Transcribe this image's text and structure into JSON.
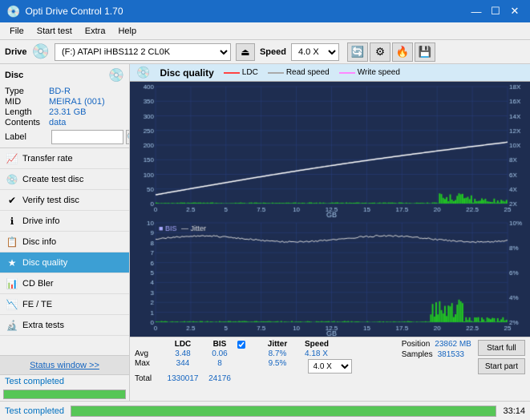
{
  "titleBar": {
    "icon": "💿",
    "title": "Opti Drive Control 1.70",
    "minimizeBtn": "—",
    "maximizeBtn": "☐",
    "closeBtn": "✕"
  },
  "menuBar": {
    "items": [
      "File",
      "Start test",
      "Extra",
      "Help"
    ]
  },
  "driveBar": {
    "label": "Drive",
    "driveValue": "(F:)  ATAPI iHBS112  2 CL0K",
    "speedLabel": "Speed",
    "speedValue": "4.0 X"
  },
  "disc": {
    "title": "Disc",
    "typeLabel": "Type",
    "typeValue": "BD-R",
    "midLabel": "MID",
    "midValue": "MEIRA1 (001)",
    "lengthLabel": "Length",
    "lengthValue": "23.31 GB",
    "contentsLabel": "Contents",
    "contentsValue": "data",
    "labelLabel": "Label"
  },
  "navItems": [
    {
      "id": "transfer-rate",
      "label": "Transfer rate",
      "icon": "📈"
    },
    {
      "id": "create-test-disc",
      "label": "Create test disc",
      "icon": "💿"
    },
    {
      "id": "verify-test-disc",
      "label": "Verify test disc",
      "icon": "✔"
    },
    {
      "id": "drive-info",
      "label": "Drive info",
      "icon": "ℹ"
    },
    {
      "id": "disc-info",
      "label": "Disc info",
      "icon": "📋"
    },
    {
      "id": "disc-quality",
      "label": "Disc quality",
      "icon": "★",
      "active": true
    },
    {
      "id": "cd-bler",
      "label": "CD Bler",
      "icon": "📊"
    },
    {
      "id": "fe-te",
      "label": "FE / TE",
      "icon": "📉"
    },
    {
      "id": "extra-tests",
      "label": "Extra tests",
      "icon": "🔬"
    }
  ],
  "statusWindow": {
    "btnLabel": "Status window >>",
    "text": "Test completed",
    "progress": 100,
    "time": "33:14"
  },
  "discQuality": {
    "title": "Disc quality",
    "legendLDC": "LDC",
    "legendReadSpeed": "Read speed",
    "legendWriteSpeed": "Write speed",
    "legendBIS": "BIS",
    "legendJitter": "Jitter"
  },
  "stats": {
    "headers": [
      "",
      "LDC",
      "BIS",
      "",
      "Jitter",
      "Speed",
      ""
    ],
    "avgLabel": "Avg",
    "avgLDC": "3.48",
    "avgBIS": "0.06",
    "avgJitter": "8.7%",
    "maxLabel": "Max",
    "maxLDC": "344",
    "maxBIS": "8",
    "maxJitter": "9.5%",
    "totalLabel": "Total",
    "totalLDC": "1330017",
    "totalBIS": "24176",
    "speedValue": "4.18 X",
    "speedSelectValue": "4.0 X",
    "positionLabel": "Position",
    "positionValue": "23862 MB",
    "samplesLabel": "Samples",
    "samplesValue": "381533",
    "startFullBtn": "Start full",
    "startPartBtn": "Start part"
  },
  "bottomBar": {
    "statusText": "Test completed",
    "progress": 100,
    "time": "33:14"
  },
  "colors": {
    "ldc": "#ff4444",
    "readSpeed": "#ffffff",
    "writeSpeed": "#ff88ff",
    "bis": "#4488ff",
    "jitter": "#ffffff",
    "chartBg": "#1e2d50",
    "gridLine": "#2a4080",
    "barGreen": "#22cc22",
    "accent": "#1a6cc7"
  }
}
